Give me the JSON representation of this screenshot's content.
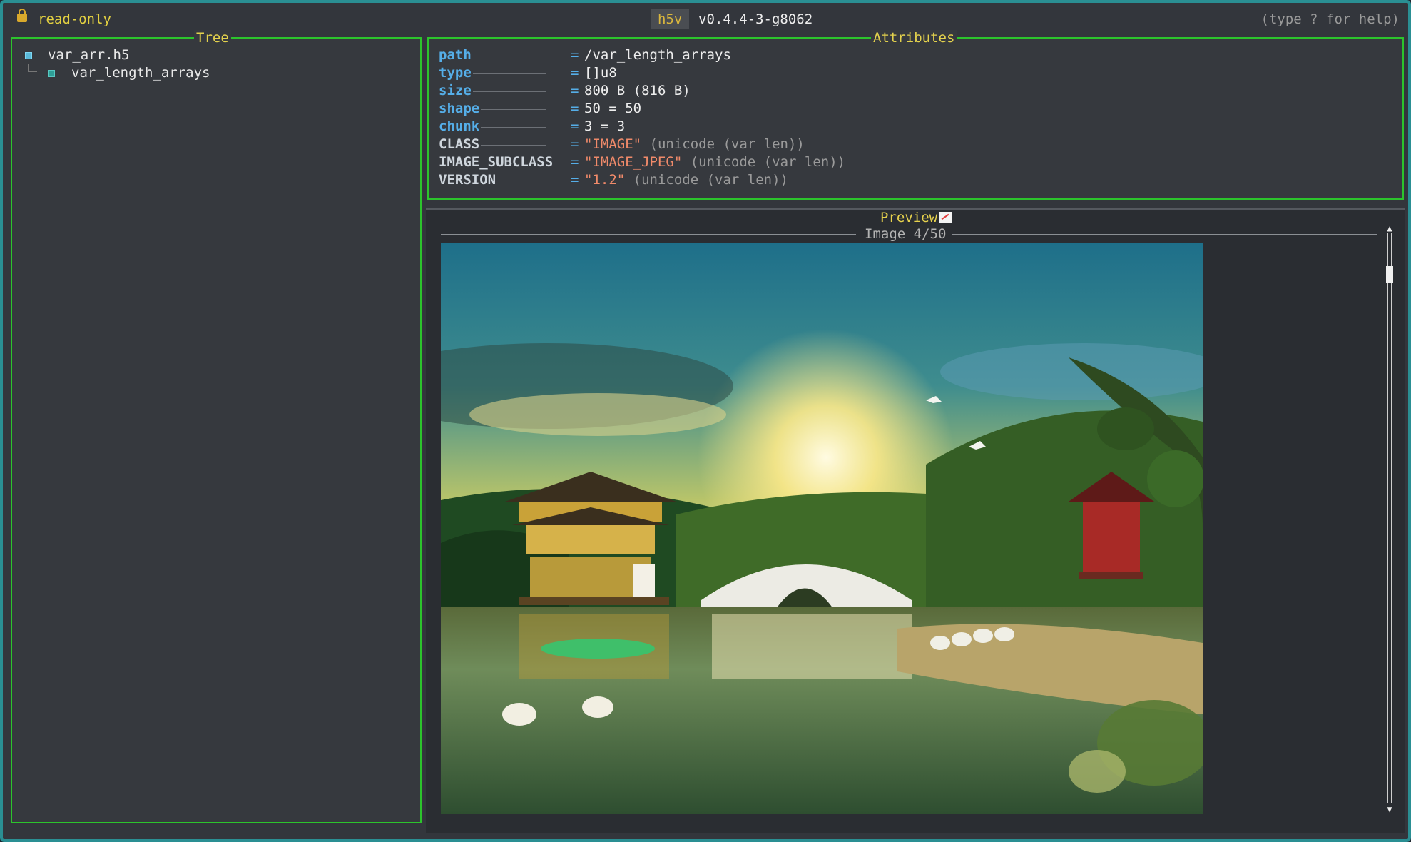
{
  "titlebar": {
    "mode": "read-only",
    "app_name": "h5v",
    "version": "v0.4.4-3-g8062",
    "help": "(type ? for help)",
    "lock_icon": "lock-icon"
  },
  "tree": {
    "title": "Tree",
    "items": [
      {
        "label": "var_arr.h5",
        "icon": "file-node-icon"
      },
      {
        "label": "var_length_arrays",
        "icon": "dataset-node-icon"
      }
    ]
  },
  "attributes": {
    "title": "Attributes",
    "rows": [
      {
        "key": "path",
        "value": "/var_length_arrays",
        "note": ""
      },
      {
        "key": "type",
        "value": "[]u8",
        "note": ""
      },
      {
        "key": "size",
        "value": "800 B (816 B)",
        "note": ""
      },
      {
        "key": "shape",
        "value": "50 = 50",
        "note": ""
      },
      {
        "key": "chunk",
        "value": "3 = 3",
        "note": ""
      },
      {
        "key": "CLASS",
        "value": "\"IMAGE\"",
        "note": "(unicode (var len))"
      },
      {
        "key": "IMAGE_SUBCLASS",
        "value": "\"IMAGE_JPEG\"",
        "note": "(unicode (var len))"
      },
      {
        "key": "VERSION",
        "value": "\"1.2\"",
        "note": "(unicode (var len))"
      }
    ],
    "equals": "="
  },
  "preview": {
    "title": "Preview",
    "image_label": "Image 4/50",
    "scroll_position": 0.06,
    "chart_icon": "chart-icon"
  },
  "colors": {
    "border_green": "#2cc42c",
    "title_yellow": "#e4d24d",
    "key_blue": "#55aee8",
    "string_orange": "#f08a6a",
    "window_border": "#2a8f93"
  }
}
